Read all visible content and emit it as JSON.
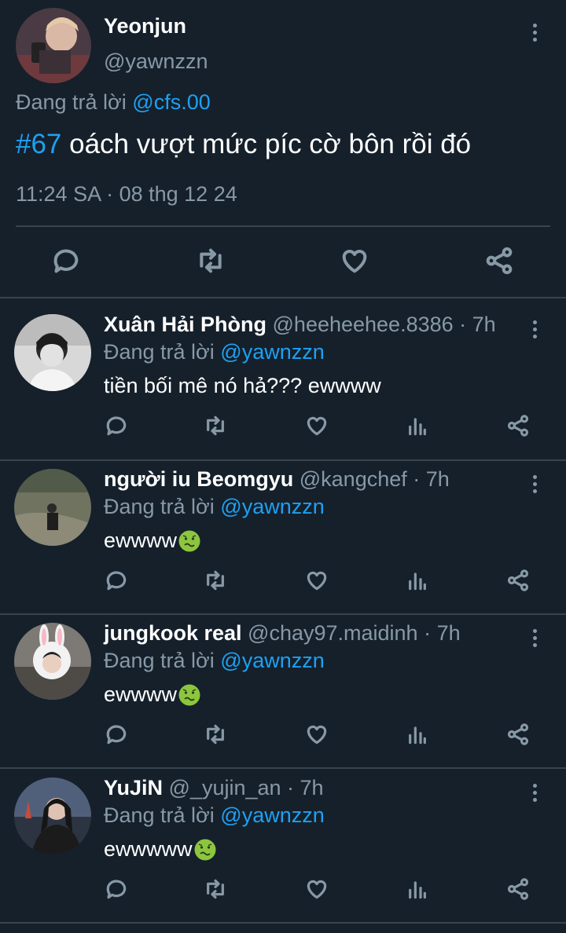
{
  "main_tweet": {
    "name": "Yeonjun",
    "handle": "@yawnzzn",
    "replying_label": "Đang trả lời",
    "replying_to": "@cfs.00",
    "hashtag": "#67",
    "text": " oách vượt mức píc cờ bôn rồi đó",
    "timestamp": "11:24 SA · 08 thg 12 24",
    "actions": [
      "reply-icon",
      "retweet-icon",
      "like-icon",
      "share-icon"
    ]
  },
  "replies": [
    {
      "name": "Xuân Hải Phòng",
      "handle": " @heeheehee.8386 · 7h",
      "replying_label": "Đang trả lời",
      "replying_to": "@yawnzzn",
      "text": "tiền bối mê nó hả??? ewwww",
      "emoji": ""
    },
    {
      "name": "người iu Beomgyu",
      "handle": " @kangchef · 7h",
      "replying_label": "Đang trả lời",
      "replying_to": "@yawnzzn",
      "text": "ewwww",
      "emoji": "nauseated-face"
    },
    {
      "name": "jungkook real",
      "handle": " @chay97.maidinh · 7h",
      "replying_label": "Đang trả lời",
      "replying_to": "@yawnzzn",
      "text": "ewwww",
      "emoji": "nauseated-face"
    },
    {
      "name": "YuJiN",
      "handle": " @_yujin_an · 7h",
      "replying_label": "Đang trả lời",
      "replying_to": "@yawnzzn",
      "text": "ewwwww",
      "emoji": "nauseated-face"
    }
  ],
  "reply_actions": [
    "reply-icon",
    "retweet-icon",
    "like-icon",
    "views-icon",
    "share-icon"
  ],
  "colors": {
    "background": "#15202b",
    "link": "#1da1f2",
    "muted": "#8899a6",
    "divider": "#38444d"
  }
}
